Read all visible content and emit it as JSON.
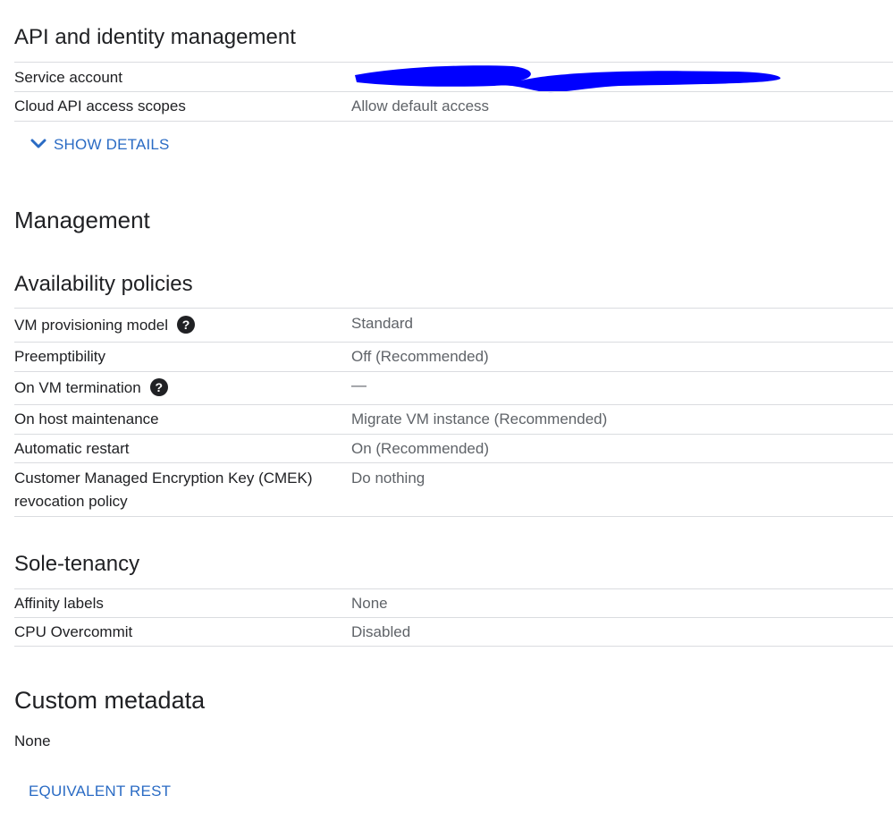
{
  "api_section": {
    "title": "API and identity management",
    "rows": [
      {
        "label": "Service account",
        "value": ""
      },
      {
        "label": "Cloud API access scopes",
        "value": "Allow default access"
      }
    ],
    "show_details_label": "SHOW DETAILS"
  },
  "management": {
    "title": "Management"
  },
  "availability": {
    "title": "Availability policies",
    "rows": [
      {
        "label": "VM provisioning model",
        "value": "Standard"
      },
      {
        "label": "Preemptibility",
        "value": "Off (Recommended)"
      },
      {
        "label": "On VM termination",
        "value": "—"
      },
      {
        "label": "On host maintenance",
        "value": "Migrate VM instance (Recommended)"
      },
      {
        "label": "Automatic restart",
        "value": "On (Recommended)"
      },
      {
        "label_line1": "Customer Managed Encryption Key (CMEK)",
        "label_line2": "revocation policy",
        "value": "Do nothing"
      }
    ],
    "help_glyph": "?"
  },
  "sole_tenancy": {
    "title": "Sole-tenancy",
    "rows": [
      {
        "label": "Affinity labels",
        "value": "None"
      },
      {
        "label": "CPU Overcommit",
        "value": "Disabled"
      }
    ]
  },
  "custom_metadata": {
    "title": "Custom metadata",
    "value": "None"
  },
  "footer": {
    "equivalent_rest_label": "EQUIVALENT REST"
  },
  "colors": {
    "link": "#2a6bc4",
    "redaction": "#0000ff",
    "divider": "#dadce0"
  },
  "icons": [
    "help-icon",
    "chevron-down-icon"
  ]
}
